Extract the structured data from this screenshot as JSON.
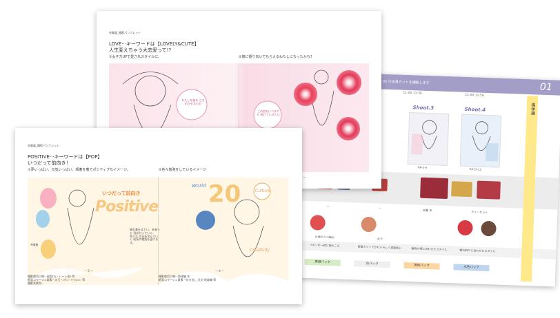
{
  "sheet_love": {
    "header_tag": "卒業展_撮影パンフレット",
    "title_line1": "LOVE···キーワードは【LOVELY&CUTE】",
    "title_line2": "人生変えちゃう大恋愛って!?",
    "caption_left": "①女子力UPで愛されスタイルに。",
    "caption_right": "②彼に振り向いてもらえるわたしになったかな?",
    "page_left": "— 1 —",
    "page_right": "— 2 —",
    "bubble1": "わたしを彼を ときめかせるもの",
    "bubble2": "この恋をいつまでも 続けていきたい"
  },
  "sheet_positive": {
    "header_tag": "卒業展_撮影パンフレット",
    "title_line1": "POSITIVE···キーワードは【POP】",
    "title_line2": "いつだって前向き！",
    "caption_left": "①夢いっぱい、元気いっぱい、晴着を着てポジティブなイメージ。",
    "caption_right": "②色々勉強をしているイメージ",
    "art_left_word": "Positive",
    "art_left_arc": "いつだって前向き",
    "art_right_tag1": "Culture",
    "art_right_tag2": "Creativity",
    "art_right_tag3": "World",
    "big_numbers": "20",
    "side_note": "※晴着",
    "page_left": "— 3 —",
    "page_right": "— 4 —",
    "notes_left": [
      "撮影使用小物···風船(丸・ハート形) 等",
      "紙面コラージュ要素···水玉 リボン マカロン 等",
      "撮影背景色···"
    ],
    "notes_right": [
      "撮影使用小物···地球儀 本",
      "紙面コラージュ要素···吹き出し 文字 地球儀 等"
    ],
    "small_caption": "晴れ着をまとい、未来へと 羽ばたいていく、色々な 文化を学んでいく 成長の物語を届けます。"
  },
  "sheet_schedule": {
    "header_label": "02 の全身カットを撮影します",
    "header_number": "01",
    "times": [
      "10:30 10:45",
      "11:00 11:30",
      "11:00 11:50"
    ],
    "shoot_labels": [
      "Shoot.3",
      "Shoot.4"
    ],
    "card_captions": [
      "P#-1-5",
      "P#13-12"
    ],
    "side_label": "媒体撮",
    "row_labels": [
      "ー",
      "ー",
      "前髪 本",
      "ティーセット"
    ],
    "hair_labels": [
      "片側で三つ編み",
      "ボブ"
    ],
    "hair_notes": [
      "リボンを一緒に編みこみ",
      "前髪カットでかわいらしく雰囲気に",
      "着物の柄に合わせたスタイル",
      "帽の飾りに合わせたスタイル"
    ],
    "bags": [
      "黄緑バック",
      "白バック",
      "黄色バック",
      "水色バック"
    ]
  },
  "colors": {
    "purple": "#a39ec7",
    "pink": "#f7c9d6",
    "yellow": "#ffe98a",
    "orange": "#fbd6a0",
    "blue": "#bfd6ee",
    "green": "#d6ecc4"
  }
}
